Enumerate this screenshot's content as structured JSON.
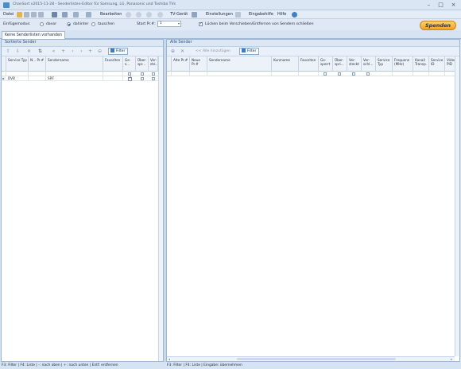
{
  "window": {
    "title": "ChanSort v2015-11-28 - Senderlisten-Editor für Samsung, LG, Panasonic und Toshiba TVs"
  },
  "menu": {
    "datei": "Datei",
    "bearbeiten": "Bearbeiten",
    "tv_geraet": "TV-Gerät",
    "einstellungen": "Einstellungen",
    "eingabehilfe": "Eingabehilfe",
    "hilfe": "Hilfe"
  },
  "options": {
    "einfuegemodus_label": "Einfügemodus:",
    "radio_davor": "davor",
    "radio_dahinter": "dahinter",
    "radio_tauschen": "tauschen",
    "start_nr_label": "Start Pr.#:",
    "start_nr_value": "1",
    "close_gap_label": "Lücken beim Verschieben/Entfernen von Sendern schließen"
  },
  "donate": {
    "label": "Spenden"
  },
  "tabs": {
    "active": "Keine Senderlisten vorhanden"
  },
  "left_panel": {
    "title": "Sortierte Sender",
    "filter_label": "Filter",
    "columns": [
      "Service Typ",
      "N... Pr.#",
      "Sendername",
      "Favoriten",
      "Ge-s...",
      "Über-spr...",
      "Ver-ste..."
    ],
    "row": {
      "service_typ": "DVB",
      "sendername": "SRF"
    },
    "status": "F3: Filter | F4: Liste | -: nach oben | +: nach unten | Entf: entfernen"
  },
  "right_panel": {
    "title": "Alle Sender",
    "add_all_label": "<< Alle hinzufügen",
    "filter_label": "Filter",
    "columns": [
      "Alte Pr.#",
      "Neue Pr.#",
      "Sendername",
      "Kurzname",
      "Favoriten",
      "Ge-sperrt",
      "Über-spri...",
      "Ver-steckt",
      "Ver-schl...",
      "Service Typ",
      "Frequenz (MHz)",
      "Kanal/ Transp.",
      "Service ID",
      "Video PID"
    ],
    "status": "F3: Filter | F4: Liste | Eingabe: übernehmen"
  },
  "colors": {
    "accent": "#2d4f85",
    "donate": "#f2a321",
    "panel_header": "#dce7f4"
  }
}
